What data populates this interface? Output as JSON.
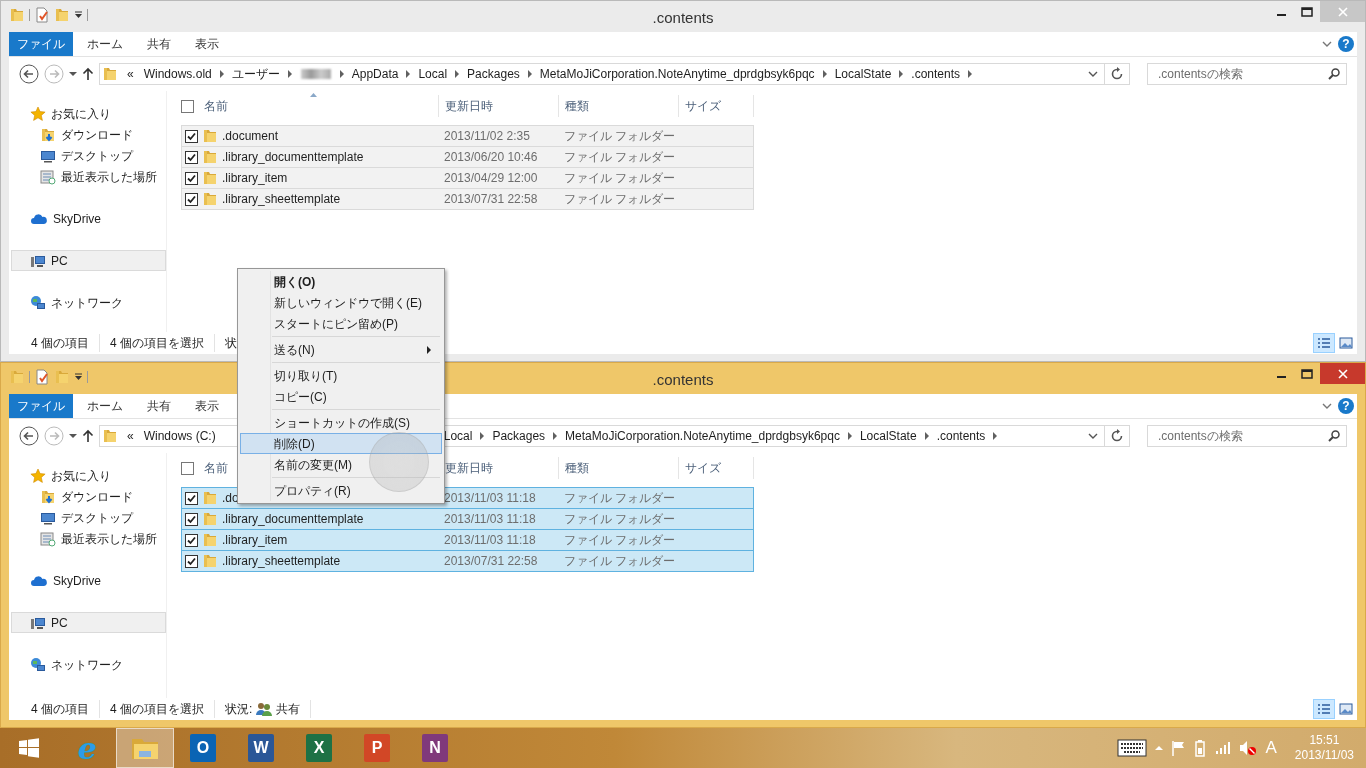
{
  "windows": [
    {
      "title": ".contents",
      "active": false,
      "quick_access": [
        {
          "kind": "folder"
        },
        {
          "kind": "properties"
        },
        {
          "kind": "new-folder"
        },
        {
          "kind": "dropdown"
        }
      ],
      "ribbon_tabs": [
        {
          "label": "ファイル",
          "kind": "file"
        },
        {
          "label": "ホーム",
          "kind": "tab"
        },
        {
          "label": "共有",
          "kind": "tab"
        },
        {
          "label": "表示",
          "kind": "tab"
        }
      ],
      "help": "?",
      "address": {
        "overflow": "«",
        "items": [
          {
            "kind": "text",
            "label": "Windows.old"
          },
          {
            "kind": "text",
            "label": "ユーザー"
          },
          {
            "kind": "blurred"
          },
          {
            "kind": "text",
            "label": "AppData"
          },
          {
            "kind": "text",
            "label": "Local"
          },
          {
            "kind": "text",
            "label": "Packages"
          },
          {
            "kind": "text",
            "label": "MetaMoJiCorporation.NoteAnytime_dprdgbsyk6pqc"
          },
          {
            "kind": "text",
            "label": "LocalState"
          },
          {
            "kind": "text",
            "label": ".contents"
          }
        ]
      },
      "search": {
        "placeholder": ".contentsの検索"
      },
      "nav": [
        {
          "label": "お気に入り",
          "kind": "star",
          "selected": false,
          "children": [
            {
              "label": "ダウンロード",
              "kind": "download",
              "selected": false
            },
            {
              "label": "デスクトップ",
              "kind": "desktop",
              "selected": false
            },
            {
              "label": "最近表示した場所",
              "kind": "recent",
              "selected": false
            }
          ]
        },
        {
          "label": "SkyDrive",
          "kind": "cloud",
          "selected": false
        },
        {
          "label": "PC",
          "kind": "pc",
          "selected": true
        },
        {
          "label": "ネットワーク",
          "kind": "network",
          "selected": false
        }
      ],
      "select_all": {
        "checked": false
      },
      "columns": [
        {
          "label": "名前",
          "sorted": true
        },
        {
          "label": "更新日時",
          "sorted": false
        },
        {
          "label": "種類",
          "sorted": false
        },
        {
          "label": "サイズ",
          "sorted": false
        }
      ],
      "rows": [
        {
          "name": ".document",
          "date": "2013/11/02 2:35",
          "type": "ファイル フォルダー",
          "checked": true,
          "selected": true
        },
        {
          "name": ".library_documenttemplate",
          "date": "2013/06/20 10:46",
          "type": "ファイル フォルダー",
          "checked": true,
          "selected": true
        },
        {
          "name": ".library_item",
          "date": "2013/04/29 12:00",
          "type": "ファイル フォルダー",
          "checked": true,
          "selected": true
        },
        {
          "name": ".library_sheettemplate",
          "date": "2013/07/31 22:58",
          "type": "ファイル フォルダー",
          "checked": true,
          "selected": true
        }
      ],
      "status": {
        "item_count": "4 個の項目",
        "selection": "4 個の項目を選択",
        "state_label": "状"
      },
      "views": [
        {
          "kind": "details",
          "selected": true
        },
        {
          "kind": "large-icons",
          "selected": false
        }
      ]
    },
    {
      "title": ".contents",
      "active": true,
      "quick_access": [
        {
          "kind": "folder"
        },
        {
          "kind": "properties"
        },
        {
          "kind": "new-folder"
        },
        {
          "kind": "dropdown"
        }
      ],
      "ribbon_tabs": [
        {
          "label": "ファイル",
          "kind": "file"
        },
        {
          "label": "ホーム",
          "kind": "tab"
        },
        {
          "label": "共有",
          "kind": "tab"
        },
        {
          "label": "表示",
          "kind": "tab"
        }
      ],
      "help": "?",
      "address": {
        "overflow": "«",
        "items": [
          {
            "kind": "text",
            "label": "Windows (C:)"
          },
          {
            "kind": "covered"
          },
          {
            "kind": "text",
            "label": "Local"
          },
          {
            "kind": "text",
            "label": "Packages"
          },
          {
            "kind": "text",
            "label": "MetaMoJiCorporation.NoteAnytime_dprdgbsyk6pqc"
          },
          {
            "kind": "text",
            "label": "LocalState"
          },
          {
            "kind": "text",
            "label": ".contents"
          }
        ]
      },
      "search": {
        "placeholder": ".contentsの検索"
      },
      "nav": [
        {
          "label": "お気に入り",
          "kind": "star",
          "selected": false,
          "children": [
            {
              "label": "ダウンロード",
              "kind": "download",
              "selected": false
            },
            {
              "label": "デスクトップ",
              "kind": "desktop",
              "selected": false
            },
            {
              "label": "最近表示した場所",
              "kind": "recent",
              "selected": false
            }
          ]
        },
        {
          "label": "SkyDrive",
          "kind": "cloud",
          "selected": false
        },
        {
          "label": "PC",
          "kind": "pc",
          "selected": true
        },
        {
          "label": "ネットワーク",
          "kind": "network",
          "selected": false
        }
      ],
      "select_all": {
        "checked": false
      },
      "columns": [
        {
          "label": "名前"
        },
        {
          "label": "更新日時"
        },
        {
          "label": "種類"
        },
        {
          "label": "サイズ"
        }
      ],
      "rows": [
        {
          "name": ".do",
          "date": "2013/11/03 11:18",
          "type": "ファイル フォルダー",
          "checked": true,
          "selected": true
        },
        {
          "name": ".library_documenttemplate",
          "date": "2013/11/03 11:18",
          "type": "ファイル フォルダー",
          "checked": true,
          "selected": true
        },
        {
          "name": ".library_item",
          "date": "2013/11/03 11:18",
          "type": "ファイル フォルダー",
          "checked": true,
          "selected": true
        },
        {
          "name": ".library_sheettemplate",
          "date": "2013/07/31 22:58",
          "type": "ファイル フォルダー",
          "checked": true,
          "selected": true
        }
      ],
      "status": {
        "item_count": "4 個の項目",
        "selection": "4 個の項目を選択",
        "state_label": "状況:",
        "state_value": "共有"
      },
      "views": [
        {
          "kind": "details",
          "selected": true
        },
        {
          "kind": "large-icons",
          "selected": false
        }
      ]
    }
  ],
  "context_menu": {
    "items": [
      {
        "kind": "item",
        "label": "開く(O)",
        "bold": true,
        "submenu": false,
        "selected": false
      },
      {
        "kind": "item",
        "label": "新しいウィンドウで開く(E)",
        "bold": false,
        "submenu": false,
        "selected": false
      },
      {
        "kind": "item",
        "label": "スタートにピン留め(P)",
        "bold": false,
        "submenu": false,
        "selected": false
      },
      {
        "kind": "separator"
      },
      {
        "kind": "item",
        "label": "送る(N)",
        "bold": false,
        "submenu": true,
        "selected": false
      },
      {
        "kind": "separator"
      },
      {
        "kind": "item",
        "label": "切り取り(T)",
        "bold": false,
        "submenu": false,
        "selected": false
      },
      {
        "kind": "item",
        "label": "コピー(C)",
        "bold": false,
        "submenu": false,
        "selected": false
      },
      {
        "kind": "separator"
      },
      {
        "kind": "item",
        "label": "ショートカットの作成(S)",
        "bold": false,
        "submenu": false,
        "selected": false
      },
      {
        "kind": "item",
        "label": "削除(D)",
        "bold": false,
        "submenu": false,
        "selected": true
      },
      {
        "kind": "item",
        "label": "名前の変更(M)",
        "bold": false,
        "submenu": false,
        "selected": false
      },
      {
        "kind": "separator"
      },
      {
        "kind": "item",
        "label": "プロパティ(R)",
        "bold": false,
        "submenu": false,
        "selected": false
      }
    ]
  },
  "taskbar": {
    "apps": [
      {
        "kind": "ie",
        "letter": "e",
        "selected": false
      },
      {
        "kind": "explorer",
        "selected": true
      },
      {
        "kind": "outlook",
        "letter": "O",
        "selected": false
      },
      {
        "kind": "word",
        "letter": "W",
        "selected": false
      },
      {
        "kind": "excel",
        "letter": "X",
        "selected": false
      },
      {
        "kind": "powerpoint",
        "letter": "P",
        "selected": false
      },
      {
        "kind": "onenote",
        "letter": "N",
        "selected": false
      }
    ],
    "ime": "A",
    "time": "15:51",
    "date": "2013/11/03"
  }
}
